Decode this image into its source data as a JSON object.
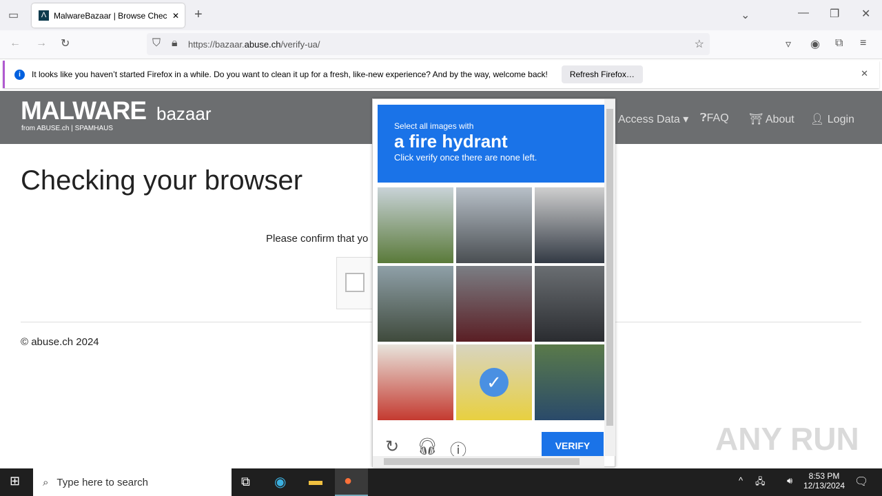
{
  "browser": {
    "tab_title": "MalwareBazaar | Browse Checking",
    "url_prefix": "https://bazaar.",
    "url_domain": "abuse.ch",
    "url_path": "/verify-ua/"
  },
  "notification": {
    "text": "It looks like you haven’t started Firefox in a while. Do you want to clean it up for a fresh, like-new experience? And by the way, welcome back!",
    "button": "Refresh Firefox…"
  },
  "site": {
    "logo_main": "MALWARE",
    "logo_sub": "bazaar",
    "logo_from": "from ABUSE.ch | SPAMHAUS",
    "nav": [
      "Access Data",
      "FAQ",
      "About",
      "Login"
    ]
  },
  "page": {
    "title": "Checking your browser",
    "confirm": "Please confirm that yo",
    "footer": "© abuse.ch 2024"
  },
  "captcha": {
    "prompt": "Select all images with",
    "object": "a fire hydrant",
    "instruction": "Click verify once there are none left.",
    "verify": "VERIFY",
    "tiles": [
      {
        "colors": [
          "#c9d3d8",
          "#5a7a3a"
        ],
        "selected": false
      },
      {
        "colors": [
          "#b8c0c8",
          "#4a4e52"
        ],
        "selected": false
      },
      {
        "colors": [
          "#cfcfcf",
          "#333a44"
        ],
        "selected": false
      },
      {
        "colors": [
          "#8fa0a8",
          "#3f4a3c"
        ],
        "selected": false
      },
      {
        "colors": [
          "#7b7e84",
          "#5a1e24"
        ],
        "selected": false
      },
      {
        "colors": [
          "#6a6e72",
          "#2a2c30"
        ],
        "selected": false
      },
      {
        "colors": [
          "#e8e4dc",
          "#c43a30"
        ],
        "selected": false
      },
      {
        "colors": [
          "#d8d4c0",
          "#e8d040"
        ],
        "selected": true
      },
      {
        "colors": [
          "#5a7a4a",
          "#2a4a6a"
        ],
        "selected": false
      }
    ]
  },
  "taskbar": {
    "search_placeholder": "Type here to search",
    "time": "8:53 PM",
    "date": "12/13/2024"
  },
  "watermark": "ANY RUN"
}
